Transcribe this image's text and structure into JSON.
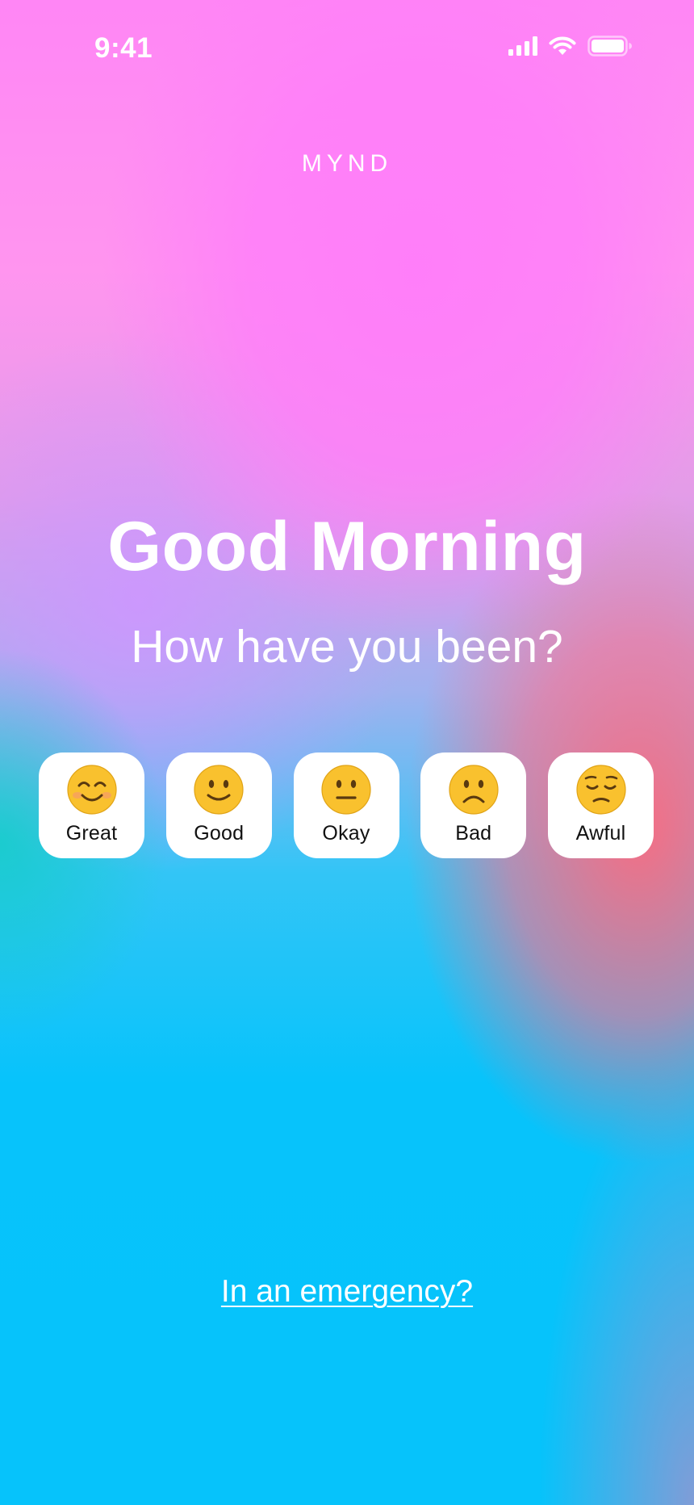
{
  "status_bar": {
    "time": "9:41",
    "icons": [
      "cellular-signal-icon",
      "wifi-icon",
      "battery-icon"
    ]
  },
  "brand": "MYND",
  "greeting": {
    "title": "Good Morning",
    "question": "How have you been?"
  },
  "moods": [
    {
      "label": "Great",
      "icon": "smiling-face-icon"
    },
    {
      "label": "Good",
      "icon": "slightly-smiling-face-icon"
    },
    {
      "label": "Okay",
      "icon": "neutral-face-icon"
    },
    {
      "label": "Bad",
      "icon": "frowning-face-icon"
    },
    {
      "label": "Awful",
      "icon": "pensive-face-icon"
    }
  ],
  "emergency_link": "In an emergency?",
  "colors": {
    "text": "#ffffff",
    "card": "#ffffff",
    "label": "#111111",
    "emoji_face": "#f9c12e",
    "emoji_feature": "#5a3a10",
    "bg_pink": "#ff86f5",
    "bg_blue": "#06c3fb",
    "bg_coral": "#ff6a7d"
  }
}
